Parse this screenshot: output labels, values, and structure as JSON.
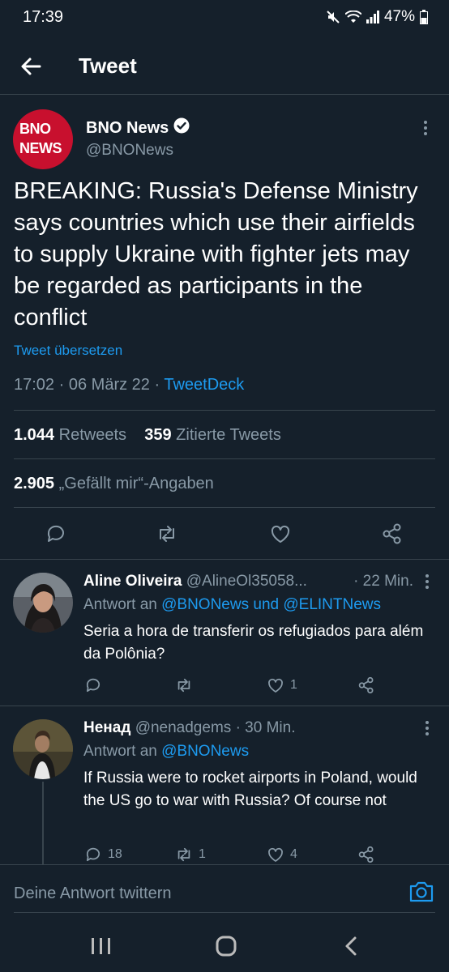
{
  "status": {
    "time": "17:39",
    "battery": "47%"
  },
  "header": {
    "title": "Tweet"
  },
  "tweet": {
    "avatar_line1": "BNO",
    "avatar_line2": "NEWS",
    "author": "BNO News",
    "handle": "@BNONews",
    "text": "BREAKING: Russia's Defense Ministry says countries which use their airfields to supply Ukraine with fighter jets may be regarded as participants in the conflict",
    "translate": "Tweet übersetzen",
    "time": "17:02",
    "date": "06 März 22",
    "separator": "·",
    "source": "TweetDeck",
    "retweets_count": "1.044",
    "retweets_label": "Retweets",
    "quotes_count": "359",
    "quotes_label": "Zitierte Tweets",
    "likes_count": "2.905",
    "likes_label": "„Gefällt mir“-Angaben"
  },
  "replies": [
    {
      "name": "Aline Oliveira",
      "handle": "@AlineOl35058...",
      "time": "· 22 Min.",
      "reply_prefix": "Antwort an",
      "reply_to1": "@BNONews",
      "reply_and": "und",
      "reply_to2": "@ELINTNews",
      "text": "Seria a hora de transferir os refugiados para além da Polônia?",
      "reply_count": "",
      "retweet_count": "",
      "like_count": "1"
    },
    {
      "name": "Ненад",
      "handle": "@nenadgems",
      "time": "· 30 Min.",
      "reply_prefix": "Antwort an",
      "reply_to1": "@BNONews",
      "text": "If Russia were to rocket airports in Poland, would the US go to war with Russia? Of course not",
      "reply_count": "18",
      "retweet_count": "1",
      "like_count": "4"
    }
  ],
  "compose": {
    "placeholder": "Deine Antwort twittern"
  },
  "colors": {
    "background": "#15202b",
    "accent": "#1d9bf0",
    "muted": "#8899a6",
    "border": "#38444d",
    "bno_red": "#c8102e"
  }
}
